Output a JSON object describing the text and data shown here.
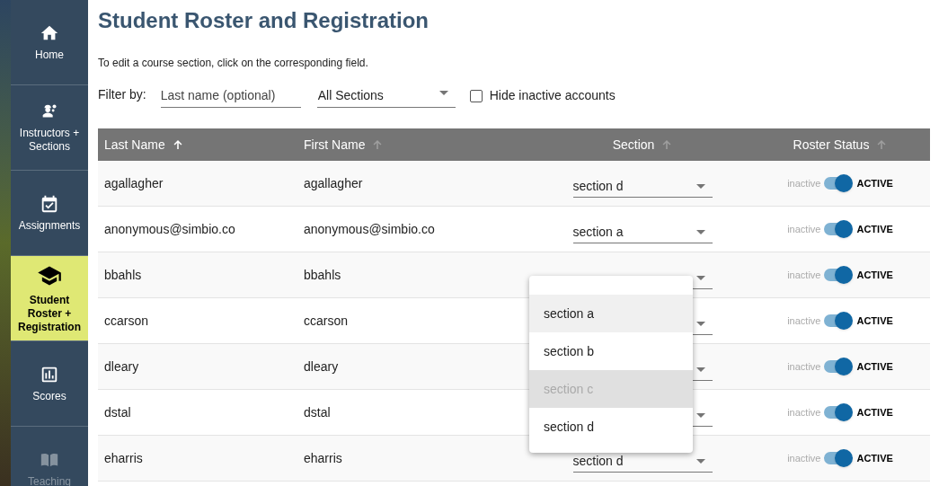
{
  "sidebar": {
    "items": [
      {
        "kind": "home",
        "label": "Home",
        "selected": false,
        "disabled": false
      },
      {
        "kind": "instructors",
        "label": "Instructors + Sections",
        "selected": false,
        "disabled": false
      },
      {
        "kind": "assignments",
        "label": "Assignments",
        "selected": false,
        "disabled": false
      },
      {
        "kind": "roster",
        "label": "Student Roster + Registration",
        "selected": true,
        "disabled": false
      },
      {
        "kind": "scores",
        "label": "Scores",
        "selected": false,
        "disabled": false
      },
      {
        "kind": "resources",
        "label": "Teaching",
        "selected": false,
        "disabled": true
      }
    ]
  },
  "title": "Student Roster and Registration",
  "instructions": "To edit a course section, click on the corresponding field.",
  "filter": {
    "label": "Filter by:",
    "name_placeholder": "Last name (optional)",
    "section_value": "All Sections",
    "hide_inactive": {
      "label": "Hide inactive accounts",
      "checked": false
    }
  },
  "table": {
    "columns": [
      {
        "label": "Last Name",
        "sorted": true
      },
      {
        "label": "First Name",
        "sorted": false
      },
      {
        "label": "Section",
        "sorted": false
      },
      {
        "label": "Roster Status",
        "sorted": false
      }
    ],
    "rows": [
      {
        "last_name": "agallagher",
        "first_name": "agallagher",
        "section": "section d",
        "status": {
          "off_label": "inactive",
          "on_label": "ACTIVE",
          "on": true
        }
      },
      {
        "last_name": "anonymous@simbio.co",
        "first_name": "anonymous@simbio.co",
        "section": "section a",
        "status": {
          "off_label": "inactive",
          "on_label": "ACTIVE",
          "on": true
        }
      },
      {
        "last_name": "bbahls",
        "first_name": "bbahls",
        "status": {
          "off_label": "inactive",
          "on_label": "ACTIVE",
          "on": true
        }
      },
      {
        "last_name": "ccarson",
        "first_name": "ccarson",
        "status": {
          "off_label": "inactive",
          "on_label": "ACTIVE",
          "on": true
        }
      },
      {
        "last_name": "dleary",
        "first_name": "dleary",
        "status": {
          "off_label": "inactive",
          "on_label": "ACTIVE",
          "on": true
        }
      },
      {
        "last_name": "dstal",
        "first_name": "dstal",
        "status": {
          "off_label": "inactive",
          "on_label": "ACTIVE",
          "on": true
        }
      },
      {
        "last_name": "eharris",
        "first_name": "eharris",
        "section": "section d",
        "status": {
          "off_label": "inactive",
          "on_label": "ACTIVE",
          "on": true
        }
      }
    ]
  },
  "section_menu": {
    "options": [
      {
        "label": "section a",
        "highlighted": true,
        "selected": false,
        "disabled": false
      },
      {
        "label": "section b",
        "highlighted": false,
        "selected": false,
        "disabled": false
      },
      {
        "label": "section c",
        "highlighted": false,
        "selected": true,
        "disabled": true
      },
      {
        "label": "section d",
        "highlighted": false,
        "selected": false,
        "disabled": false
      }
    ]
  }
}
